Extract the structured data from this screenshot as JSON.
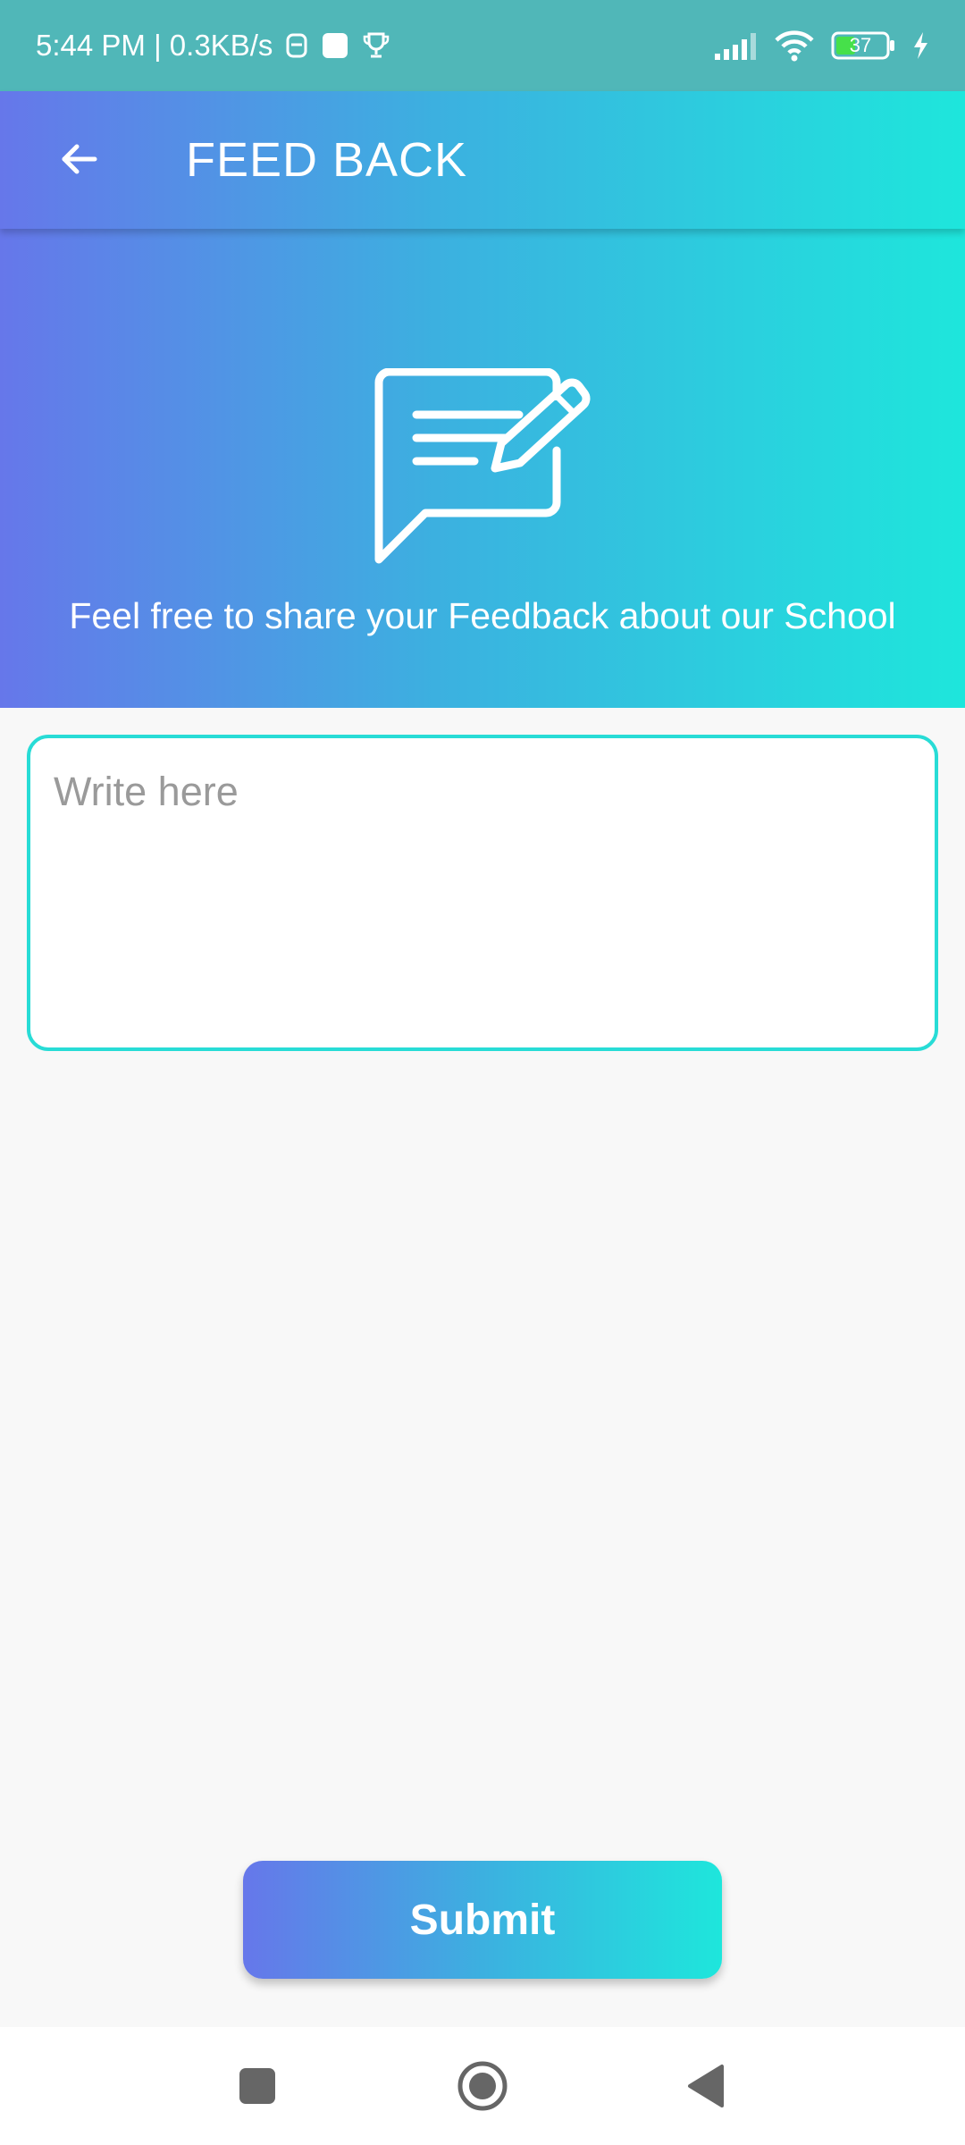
{
  "status_bar": {
    "time_speed": "5:44 PM | 0.3KB/s",
    "battery_level": "37",
    "icons": [
      "notification-app-icon",
      "square-notification-icon",
      "trophy-icon",
      "signal-icon",
      "wifi-icon",
      "battery-icon",
      "charging-bolt-icon"
    ]
  },
  "app_bar": {
    "back_icon": "arrow-left-icon",
    "title": "FEED BACK"
  },
  "hero": {
    "icon": "feedback-message-edit-icon",
    "message": "Feel free to share your Feedback about our School"
  },
  "feedback": {
    "placeholder": "Write here",
    "value": ""
  },
  "submit": {
    "label": "Submit"
  },
  "nav_bar": {
    "icons": [
      "recent-apps-icon",
      "home-icon",
      "back-icon"
    ]
  },
  "colors": {
    "status_bar": "#50b7b8",
    "gradient_start": "#6677ea",
    "gradient_end": "#1ee6dc",
    "input_border": "#28dcd6",
    "background": "#f8f8f8"
  }
}
